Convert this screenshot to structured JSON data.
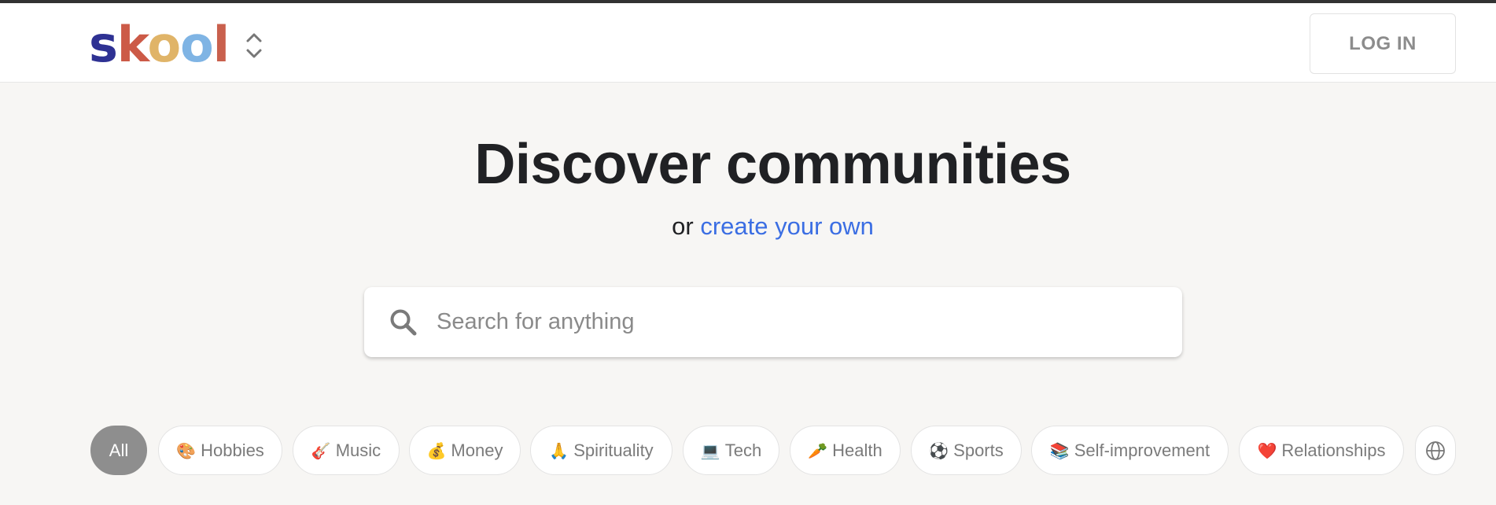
{
  "brand": {
    "logo_letters": [
      "s",
      "k",
      "o",
      "o",
      "l"
    ]
  },
  "header": {
    "login_label": "LOG IN"
  },
  "hero": {
    "title": "Discover communities",
    "subtitle_prefix": "or",
    "subtitle_link": "create your own"
  },
  "search": {
    "placeholder": "Search for anything",
    "icon": "search-icon"
  },
  "categories": [
    {
      "emoji": "",
      "label": "All",
      "active": true
    },
    {
      "emoji": "🎨",
      "label": "Hobbies"
    },
    {
      "emoji": "🎸",
      "label": "Music"
    },
    {
      "emoji": "💰",
      "label": "Money"
    },
    {
      "emoji": "🙏",
      "label": "Spirituality"
    },
    {
      "emoji": "💻",
      "label": "Tech"
    },
    {
      "emoji": "🥕",
      "label": "Health"
    },
    {
      "emoji": "⚽",
      "label": "Sports"
    },
    {
      "emoji": "📚",
      "label": "Self-improvement"
    },
    {
      "emoji": "❤️",
      "label": "Relationships"
    }
  ],
  "colors": {
    "logo": [
      "#2e3193",
      "#cc5a47",
      "#e0b468",
      "#7fb4e4",
      "#c9604d"
    ],
    "link": "#3b6ee3",
    "chip_active": "#8e8e8e"
  }
}
